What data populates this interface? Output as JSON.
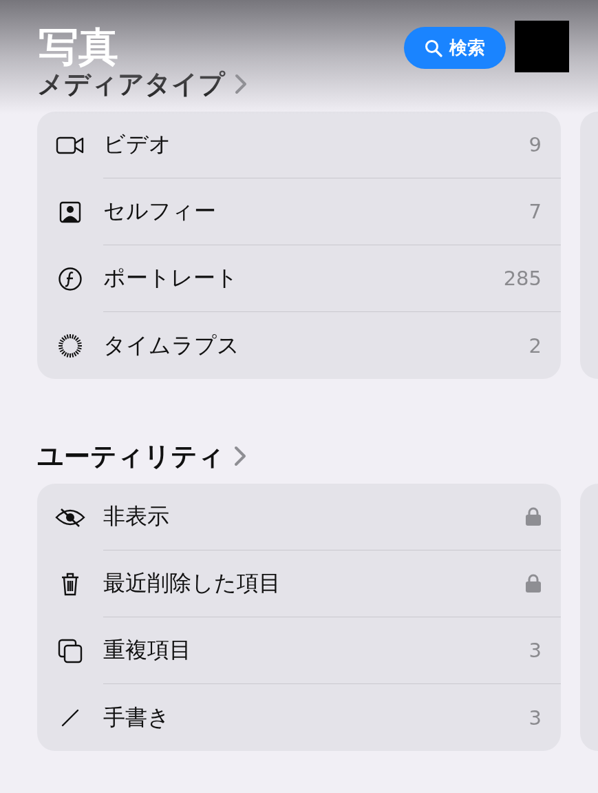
{
  "header": {
    "title": "写真",
    "search_button": "検索"
  },
  "sections": [
    {
      "heading": "メディアタイプ",
      "rows": [
        {
          "label": "ビデオ",
          "count": "9"
        },
        {
          "label": "セルフィー",
          "count": "7"
        },
        {
          "label": "ポートレート",
          "count": "285"
        },
        {
          "label": "タイムラプス",
          "count": "2"
        }
      ]
    },
    {
      "heading": "ユーティリティ",
      "rows": [
        {
          "label": "非表示",
          "locked": true
        },
        {
          "label": "最近削除した項目",
          "locked": true
        },
        {
          "label": "重複項目",
          "count": "3"
        },
        {
          "label": "手書き",
          "count": "3"
        }
      ]
    }
  ]
}
